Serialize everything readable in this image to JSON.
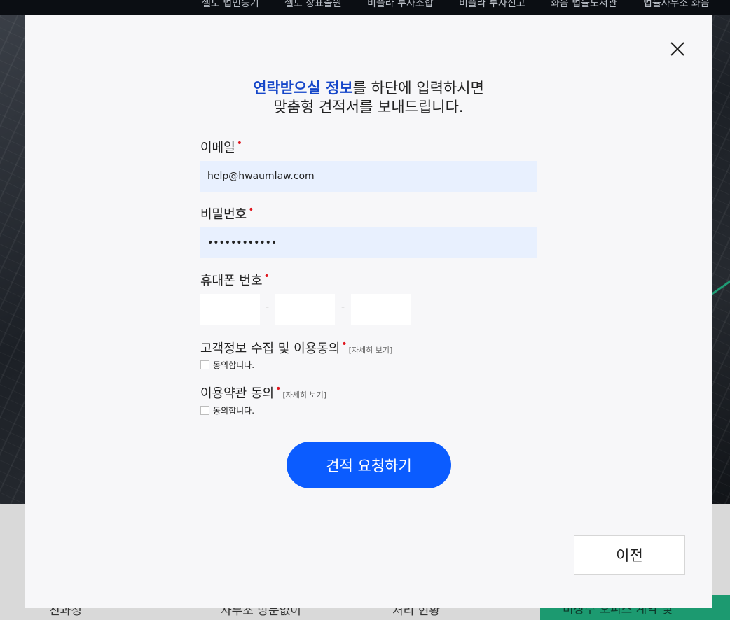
{
  "background": {
    "nav_items": [
      "셸토 법인등기",
      "셸토 상표출원",
      "비즐라 투자조합",
      "비즐라 투자신고",
      "화음 법률도서관",
      "법률사무소 화음"
    ],
    "bottom_items": [
      "진과정",
      "사무소 방문없이",
      "처리 현황"
    ],
    "bottom_green_text": "비상주 오피스 계약 및"
  },
  "modal": {
    "headline_em": "연락받으실 정보",
    "headline_rest_1": "를 하단에 입력하시면",
    "headline_line_2": "맞춤형 견적서를 보내드립니다.",
    "email": {
      "label": "이메일",
      "required_mark": "•",
      "value": "help@hwaumlaw.com"
    },
    "password": {
      "label": "비밀번호",
      "required_mark": "•",
      "value": "••••••••••••"
    },
    "phone": {
      "label": "휴대폰 번호",
      "required_mark": "•",
      "separator": "-"
    },
    "privacy_consent": {
      "label": "고객정보 수집 및 이용동의",
      "required_mark": "•",
      "detail_link": "[자세히 보기]",
      "checkbox_label": "동의합니다."
    },
    "terms_consent": {
      "label": "이용약관 동의",
      "required_mark": "•",
      "detail_link": "[자세히 보기]",
      "checkbox_label": "동의합니다."
    },
    "submit_label": "견적 요청하기",
    "prev_label": "이전",
    "close_icon": "close-icon"
  },
  "colors": {
    "accent_blue": "#0b5cff",
    "headline_blue": "#1546c9",
    "required_red": "#e0171f",
    "autofill_bg": "#e8f0fe"
  }
}
